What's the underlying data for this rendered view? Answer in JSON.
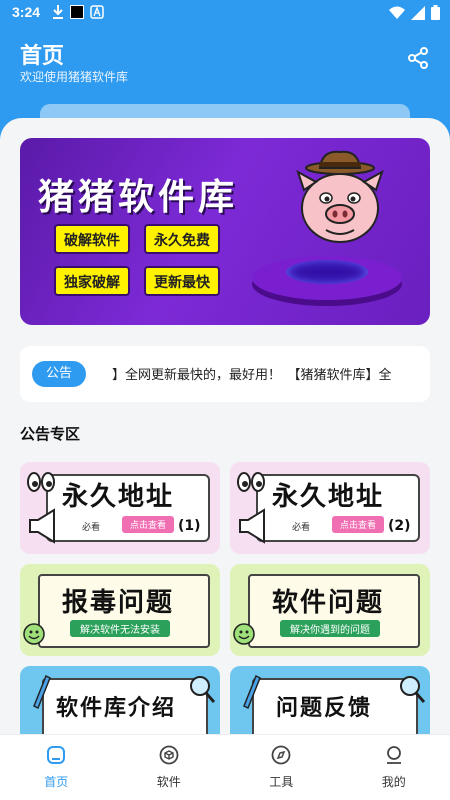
{
  "status_bar": {
    "time": "3:24"
  },
  "header": {
    "title": "首页",
    "subtitle": "欢迎使用猪猪软件库",
    "share_icon": "share-icon"
  },
  "banner": {
    "title": "猪猪软件库",
    "tags": [
      "破解软件",
      "永久免费",
      "独家破解",
      "更新最快"
    ]
  },
  "notice": {
    "badge": "公告",
    "text": "】全网更新最快的，最好用！　【猪猪软件库】全"
  },
  "section_title": "公告专区",
  "tiles": [
    {
      "main": "永久地址",
      "sub": "点击查看",
      "note": "必看",
      "num": "(1)"
    },
    {
      "main": "永久地址",
      "sub": "点击查看",
      "note": "必看",
      "num": "(2)"
    },
    {
      "main": "报毒问题",
      "sub": "解决软件无法安装"
    },
    {
      "main": "软件问题",
      "sub": "解决你遇到的问题"
    },
    {
      "main": "软件库介绍"
    },
    {
      "main": "问题反馈"
    }
  ],
  "tabbar": {
    "items": [
      {
        "label": "首页",
        "icon": "home-icon",
        "active": true
      },
      {
        "label": "软件",
        "icon": "cube-icon",
        "active": false
      },
      {
        "label": "工具",
        "icon": "compass-icon",
        "active": false
      },
      {
        "label": "我的",
        "icon": "user-icon",
        "active": false
      }
    ]
  },
  "colors": {
    "primary": "#2f9bf0",
    "tag_yellow": "#fff200",
    "banner_purple": "#6a1fbf"
  }
}
